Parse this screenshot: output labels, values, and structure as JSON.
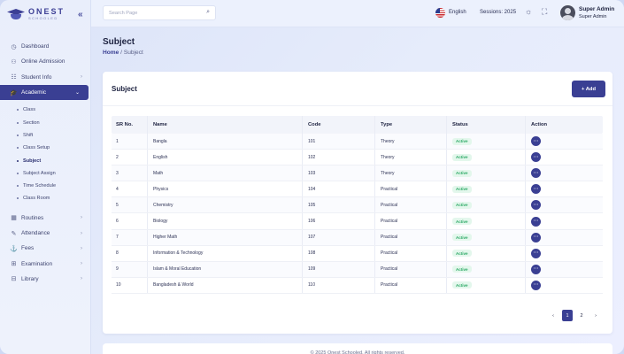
{
  "brand": {
    "title": "ONEST",
    "subtitle": "SCHOOLED"
  },
  "sidebar": {
    "items": [
      {
        "icon": "◷",
        "label": "Dashboard"
      },
      {
        "icon": "⚇",
        "label": "Online Admission"
      },
      {
        "icon": "☷",
        "label": "Student Info"
      },
      {
        "icon": "🎓",
        "label": "Academic"
      }
    ],
    "academic_sub": [
      "Class",
      "Section",
      "Shift",
      "Class Setup",
      "Subject",
      "Subject Assign",
      "Time Schedule",
      "Class Room"
    ],
    "items_after": [
      {
        "icon": "▦",
        "label": "Routines"
      },
      {
        "icon": "✎",
        "label": "Attendance"
      },
      {
        "icon": "⚓",
        "label": "Fees"
      },
      {
        "icon": "⊞",
        "label": "Examination"
      },
      {
        "icon": "⊟",
        "label": "Library"
      }
    ]
  },
  "topbar": {
    "search_placeholder": "Search Page",
    "language": "English",
    "session": "Sessions: 2025",
    "user_name": "Super Admin",
    "user_role": "Super Admin"
  },
  "page": {
    "title": "Subject",
    "breadcrumb_home": "Home",
    "breadcrumb_sep": "/",
    "breadcrumb_current": "Subject"
  },
  "card": {
    "title": "Subject",
    "add_label": "+ Add"
  },
  "table": {
    "headers": [
      "SR No.",
      "Name",
      "Code",
      "Type",
      "Status",
      "Action"
    ],
    "rows": [
      [
        "1",
        "Bangla",
        "101",
        "Theory",
        "Active"
      ],
      [
        "2",
        "English",
        "102",
        "Theory",
        "Active"
      ],
      [
        "3",
        "Math",
        "103",
        "Theory",
        "Active"
      ],
      [
        "4",
        "Physics",
        "104",
        "Practical",
        "Active"
      ],
      [
        "5",
        "Chemistry",
        "105",
        "Practical",
        "Active"
      ],
      [
        "6",
        "Biology",
        "106",
        "Practical",
        "Active"
      ],
      [
        "7",
        "Higher Math",
        "107",
        "Practical",
        "Active"
      ],
      [
        "8",
        "Information & Technology",
        "108",
        "Practical",
        "Active"
      ],
      [
        "9",
        "Islam & Moral Education",
        "109",
        "Practical",
        "Active"
      ],
      [
        "10",
        "Bangladesh & World",
        "110",
        "Practical",
        "Active"
      ]
    ],
    "action_glyph": "⋯"
  },
  "pagination": {
    "prev": "‹",
    "pages": [
      "1",
      "2"
    ],
    "next": "›"
  },
  "footer": {
    "text": "© 2025 Onest Schooled. All rights reserved."
  },
  "colors": {
    "primary": "#3a3f93",
    "active_badge": "#2aa864"
  }
}
